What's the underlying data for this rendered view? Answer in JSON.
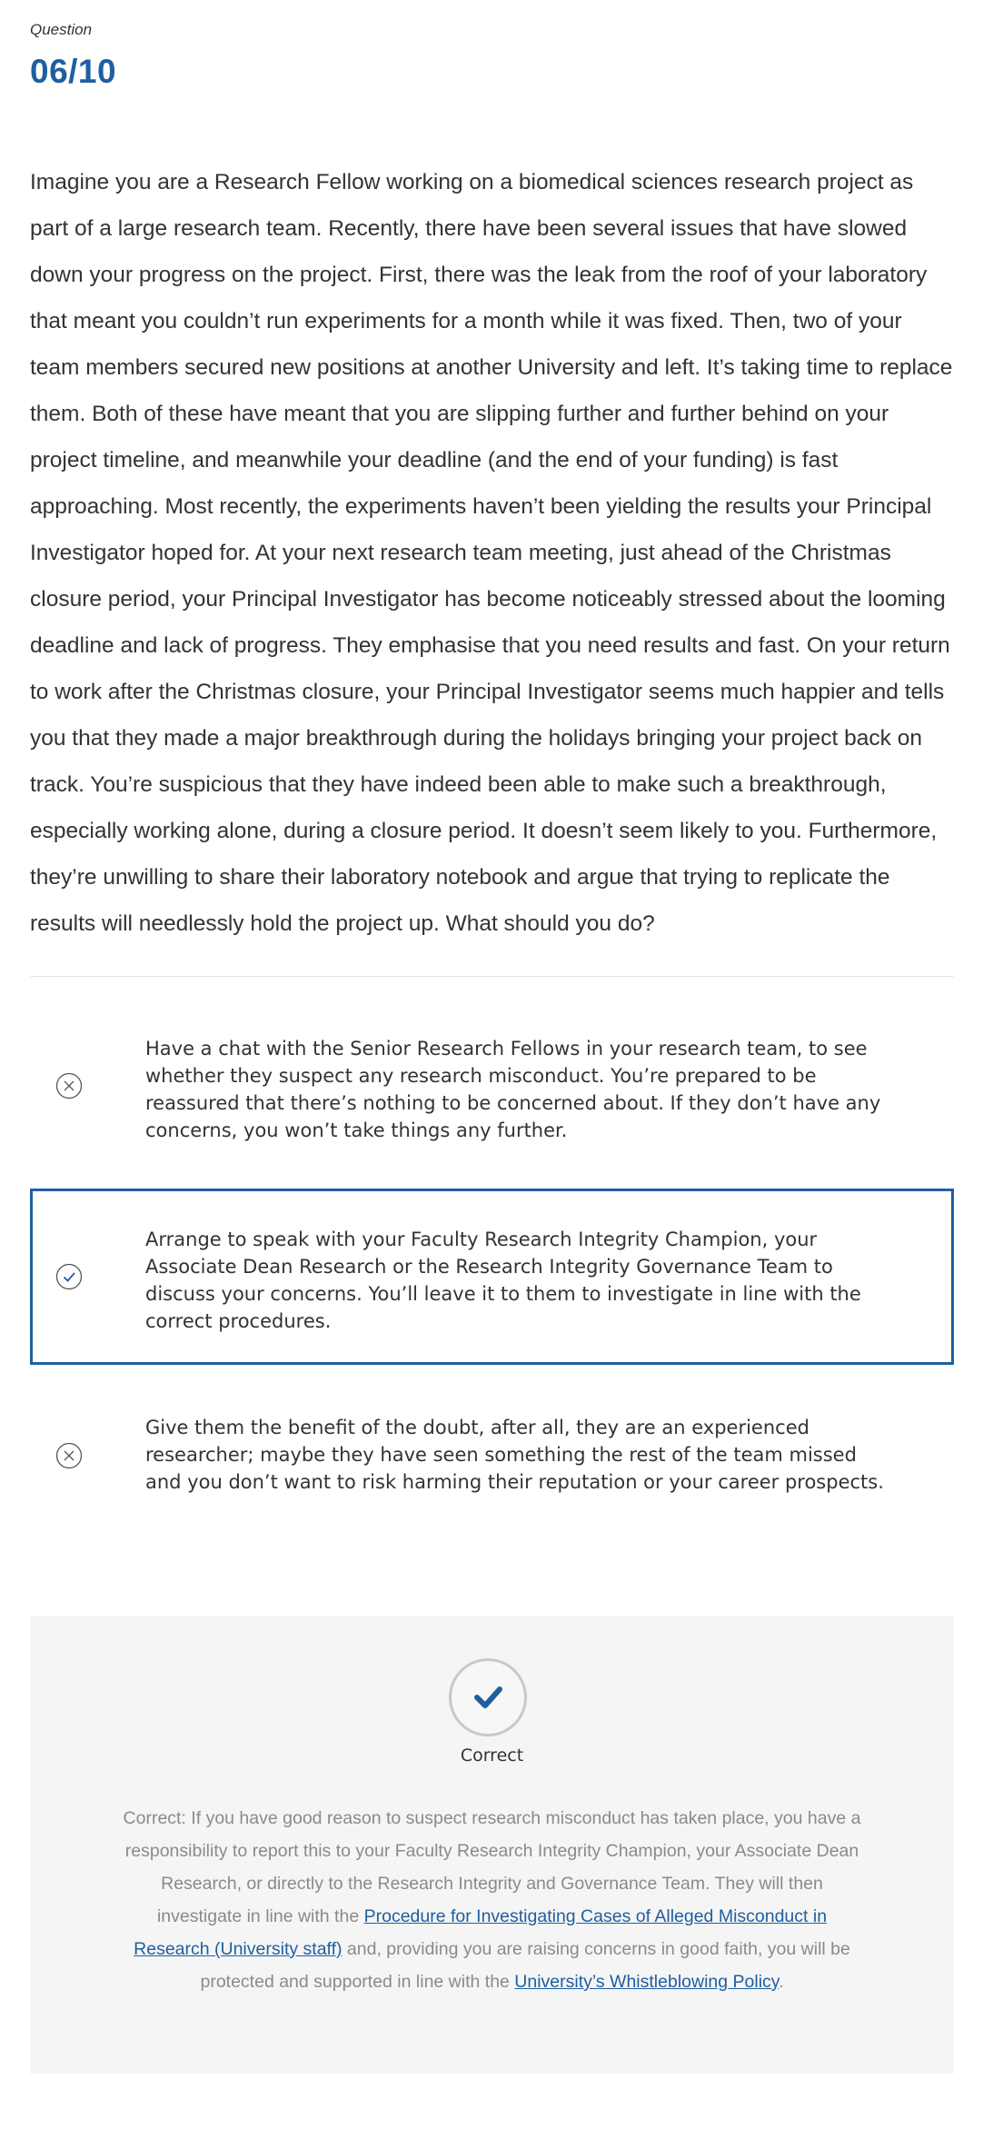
{
  "question": {
    "label": "Question",
    "number": "06/10",
    "stem": "Imagine you are a Research Fellow working on a biomedical sciences research project as part of a large research team. Recently, there have been several issues that have slowed down your progress on the project. First, there was the leak from the roof of your laboratory that meant you couldn’t run experiments for a month while it was fixed. Then, two of your team members secured new positions at another University and left. It’s taking time to replace them. Both of these have meant that you are slipping further and further behind on your project timeline, and meanwhile your deadline (and the end of your funding) is fast approaching. Most recently, the experiments haven’t been yielding the results your Principal Investigator hoped for. At your next research team meeting, just ahead of the Christmas closure period, your Principal Investigator has become noticeably stressed about the looming deadline and lack of progress. They emphasise that you need results and fast. On your return to work after the Christmas closure, your Principal Investigator seems much happier and tells you that they made a major breakthrough during the holidays bringing your project back on track. You’re suspicious that they have indeed been able to make such a breakthrough, especially working alone, during a closure period. It doesn’t seem likely to you. Furthermore, they’re unwilling to share their laboratory notebook and argue that trying to replicate the results will needlessly hold the project up. What should you do?"
  },
  "options": [
    {
      "text": "Have a chat with the Senior Research Fellows in your research team, to see whether they suspect any research misconduct. You’re prepared to be reassured that there’s nothing to be concerned about. If they don’t have any concerns, you won’t take things any further.",
      "status": "incorrect",
      "icon": "x-circle-icon"
    },
    {
      "text": "Arrange to speak with your Faculty Research Integrity Champion, your Associate Dean Research or the Research Integrity Governance Team to discuss your concerns. You’ll leave it to them to investigate in line with the correct procedures.",
      "status": "correct",
      "icon": "check-circle-icon"
    },
    {
      "text": "Give them the benefit of the doubt, after all, they are an experienced researcher; maybe they have seen something the rest of the team missed and you don’t want to risk harming their reputation or your career prospects.",
      "status": "incorrect",
      "icon": "x-circle-icon"
    }
  ],
  "feedback": {
    "icon": "checkmark-icon",
    "label": "Correct",
    "text_1": "Correct: If you have good reason to suspect research misconduct has taken place, you have a responsibility to report this to your Faculty Research Integrity Champion, your Associate Dean Research, or directly to the Research Integrity and Governance Team. They will then investigate in line with the ",
    "link_1": "Procedure for Investigating Cases of Alleged Misconduct in Research (University staff)",
    "text_2": " and, providing you are raising concerns in good faith, you will be protected and supported in line with the ",
    "link_2": "University’s Whistleblowing Policy",
    "text_3": "."
  },
  "colors": {
    "accent": "#1f5fa0",
    "feedback_bg": "#f5f5f5",
    "muted_text": "#8a8a8a"
  }
}
